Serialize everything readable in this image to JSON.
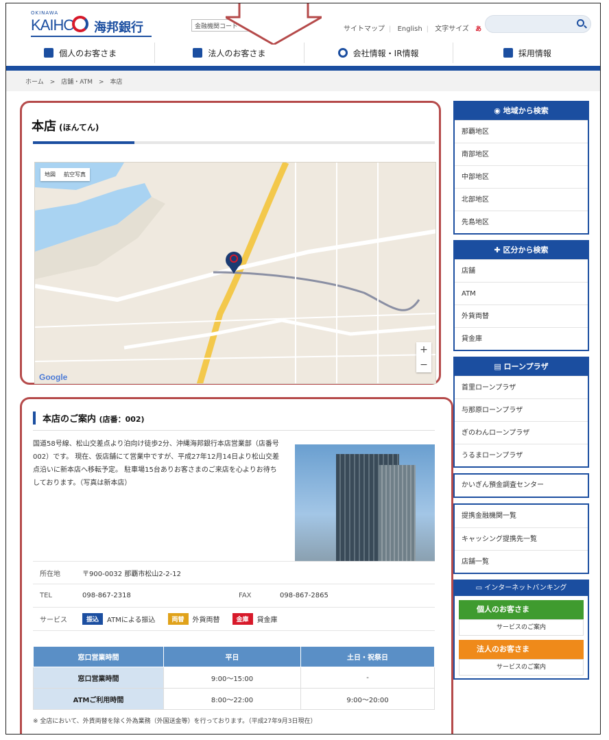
{
  "header": {
    "logo_small": "OKINAWA",
    "logo_en": "KAIHO",
    "logo_jp": "海邦銀行",
    "bank_code": "金融機関コード　0",
    "links": [
      "サイトマップ",
      "English"
    ],
    "font_size_label": "文字サイズ",
    "font_a1": "あ",
    "font_a2": "あ",
    "font_a3": "あ"
  },
  "nav": [
    {
      "label": "個人のお客さま"
    },
    {
      "label": "法人のお客さま"
    },
    {
      "label": "会社情報・IR情報"
    },
    {
      "label": "採用情報"
    }
  ],
  "breadcrumb": "ホーム　>　店舗・ATM　>　本店",
  "page_title": "本店",
  "page_title_reading": "(ほんてん)",
  "map": {
    "tab_map": "地図",
    "tab_satellite": "航空写真",
    "zoom_in": "+",
    "zoom_out": "−",
    "google": "Google"
  },
  "guide": {
    "heading": "本店のご案内",
    "heading_sub": "(店番：002)",
    "description": "国道58号線、松山交差点より泊向け徒歩2分、沖縄海邦銀行本店営業部（店番号002）です。 現在、仮店舗にて営業中ですが、平成27年12月14日より松山交差点沿いに新本店へ移転予定。 駐車場15台ありお客さまのご来店を心よりお待ちしております。（写真は新本店）",
    "address_label": "所在地",
    "address": "〒900-0032 那覇市松山2-2-12",
    "tel_label": "TEL",
    "tel": "098-867-2318",
    "fax_label": "FAX",
    "fax": "098-867-2865",
    "service_label": "サービス",
    "services": [
      {
        "badge": "振込",
        "text": "ATMによる振込",
        "color": "#1b4ea0"
      },
      {
        "badge": "両替",
        "text": "外貨両替",
        "color": "#e0a21a"
      },
      {
        "badge": "金庫",
        "text": "貸金庫",
        "color": "#d7192a"
      }
    ],
    "hours_headers": [
      "窓口営業時間",
      "平日",
      "土日・祝祭日"
    ],
    "hours_rows": [
      [
        "窓口営業時間",
        "9:00〜15:00",
        "-"
      ],
      [
        "ATMご利用時間",
        "8:00〜22:00",
        "9:00〜20:00"
      ]
    ],
    "note": "※ 全店において、外貨両替を除く外為業務（外国送金等）を行っております。（平成27年9月3日現在）"
  },
  "sidebar": {
    "region": {
      "title": "地域から検索",
      "items": [
        "那覇地区",
        "南部地区",
        "中部地区",
        "北部地区",
        "先島地区"
      ]
    },
    "category": {
      "title": "区分から検索",
      "items": [
        "店舗",
        "ATM",
        "外貨両替",
        "貸金庫"
      ]
    },
    "loan": {
      "title": "ローンプラザ",
      "items": [
        "首里ローンプラザ",
        "与那原ローンプラザ",
        "ぎのわんローンプラザ",
        "うるまローンプラザ"
      ]
    },
    "deposit_center": "かいぎん預金調査センター",
    "links": [
      "提携金融機関一覧",
      "キャッシング提携先一覧",
      "店舗一覧"
    ],
    "ib": {
      "title": "インターネットバンキング",
      "personal": "個人のお客さま",
      "corporate": "法人のお客さま",
      "service_guide": "サービスのご案内"
    }
  },
  "colors": {
    "brand": "#1b4ea0",
    "highlight": "#b54a4a",
    "green": "#3f9b2f",
    "orange": "#ef8a1a"
  }
}
